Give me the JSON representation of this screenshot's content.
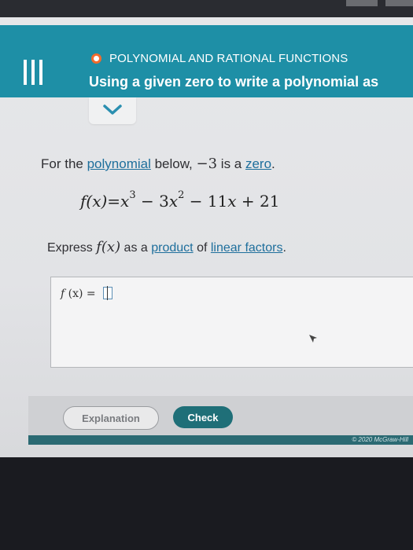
{
  "header": {
    "topic": "POLYNOMIAL AND RATIONAL FUNCTIONS",
    "title": "Using a given zero to write a polynomial as",
    "menu_icon": "hamburger-menu-icon",
    "chevron_icon": "chevron-down-icon"
  },
  "problem": {
    "prompt_prefix": "For the ",
    "prompt_link_polynomial": "polynomial",
    "prompt_middle": " below, ",
    "zero_value": "−3",
    "prompt_is_a": " is a ",
    "prompt_link_zero": "zero",
    "prompt_end": ".",
    "equation": {
      "lhs": "f(x)=",
      "var": "x",
      "exp3": "3",
      "term2": " − 3",
      "exp2": "2",
      "term3": " − 11",
      "term4": " + 21"
    },
    "express_prefix": "Express ",
    "express_fx": "f(x)",
    "express_middle": " as a ",
    "link_product": "product",
    "express_of": " of ",
    "link_linear_factors": "linear factors",
    "express_end": "."
  },
  "answer": {
    "label_f": "f",
    "label_rest": " (x) = "
  },
  "buttons": {
    "explanation": "Explanation",
    "check": "Check"
  },
  "footer": {
    "copyright": "© 2020 McGraw-Hill"
  },
  "colors": {
    "header": "#1e8fa6",
    "accent_dot": "#f36b2c",
    "link": "#1e6f9c",
    "check_button": "#1f6f78"
  }
}
